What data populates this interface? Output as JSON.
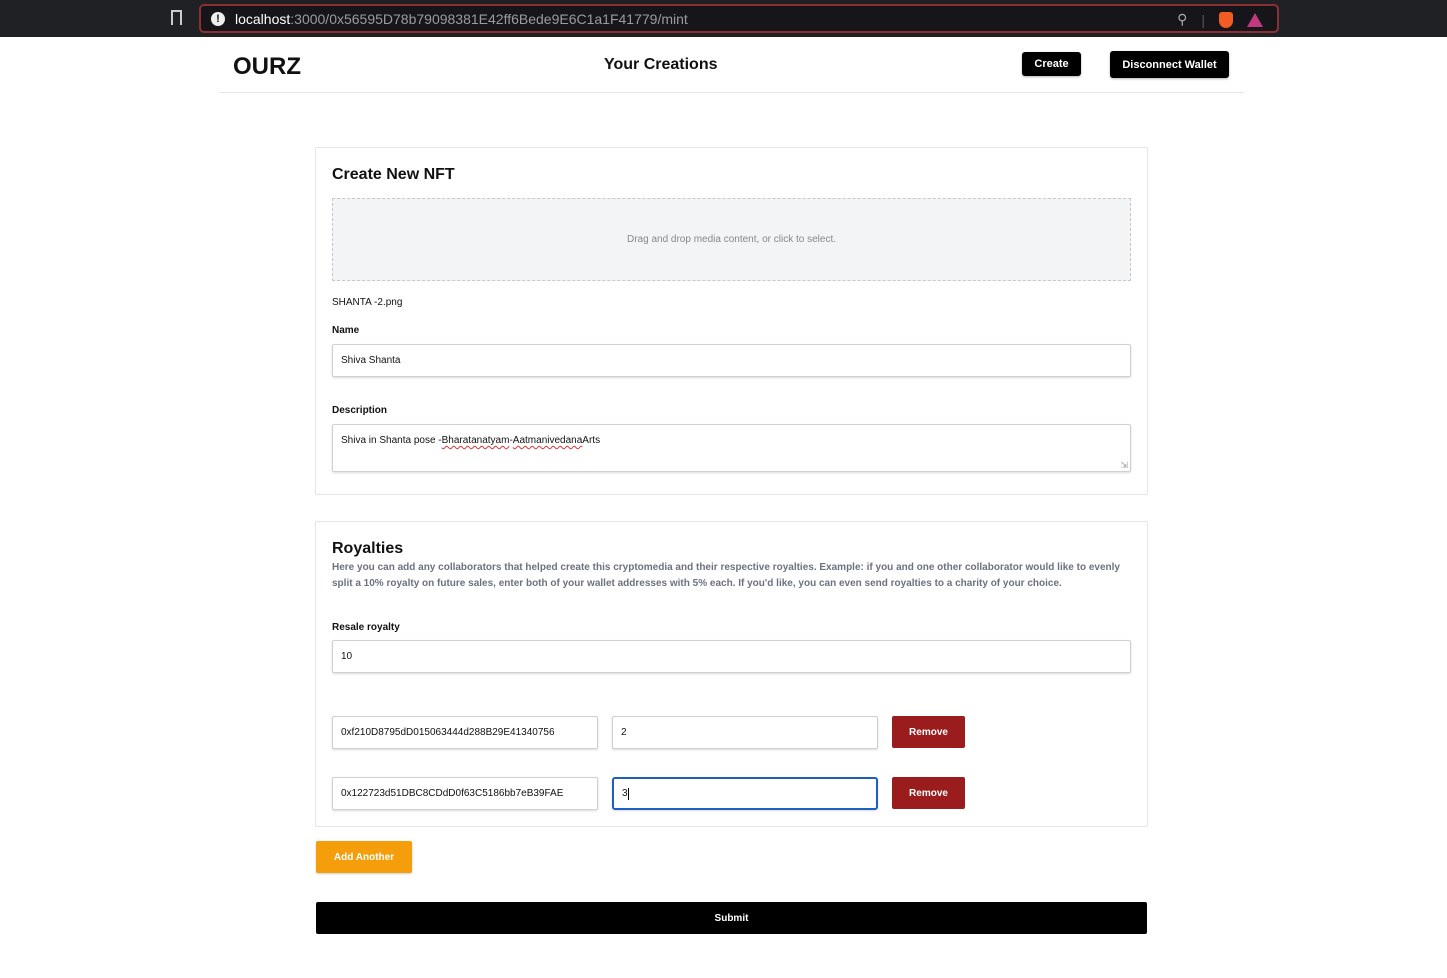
{
  "browser": {
    "url_host": "localhost",
    "url_path": ":3000/0x56595D78b79098381E42ff6Bede9E6C1a1F41779/mint"
  },
  "header": {
    "logo": "OURZ",
    "nav_title": "Your Creations",
    "create_label": "Create",
    "disconnect_label": "Disconnect Wallet"
  },
  "nft": {
    "title": "Create New NFT",
    "drop_text": "Drag and drop media content, or click to select.",
    "file_name": "SHANTA -2.png",
    "name_label": "Name",
    "name_value": "Shiva Shanta",
    "description_label": "Description",
    "description_parts": [
      "Shiva in Shanta pose - ",
      "Bharatanatyam",
      " - ",
      "Aatmanivedana",
      " Arts"
    ]
  },
  "royalties": {
    "title": "Royalties",
    "description": "Here you can add any collaborators that helped create this cryptomedia and their respective royalties. Example: if you and one other collaborator would like to evenly split a 10% royalty on future sales, enter both of your wallet addresses with 5% each. If you'd like, you can even send royalties to a charity of your choice.",
    "resale_label": "Resale royalty",
    "resale_value": "10",
    "rows": [
      {
        "address": "0xf210D8795dD015063444d288B29E41340756",
        "share": "2",
        "remove_label": "Remove"
      },
      {
        "address": "0x122723d51DBC8CDdD0f63C5186bb7eB39FAE",
        "share": "3",
        "remove_label": "Remove"
      }
    ]
  },
  "actions": {
    "add_label": "Add Another",
    "submit_label": "Submit"
  },
  "colors": {
    "remove": "#9b1c1c",
    "add": "#f59e0b",
    "focus": "#1d5fbf"
  }
}
